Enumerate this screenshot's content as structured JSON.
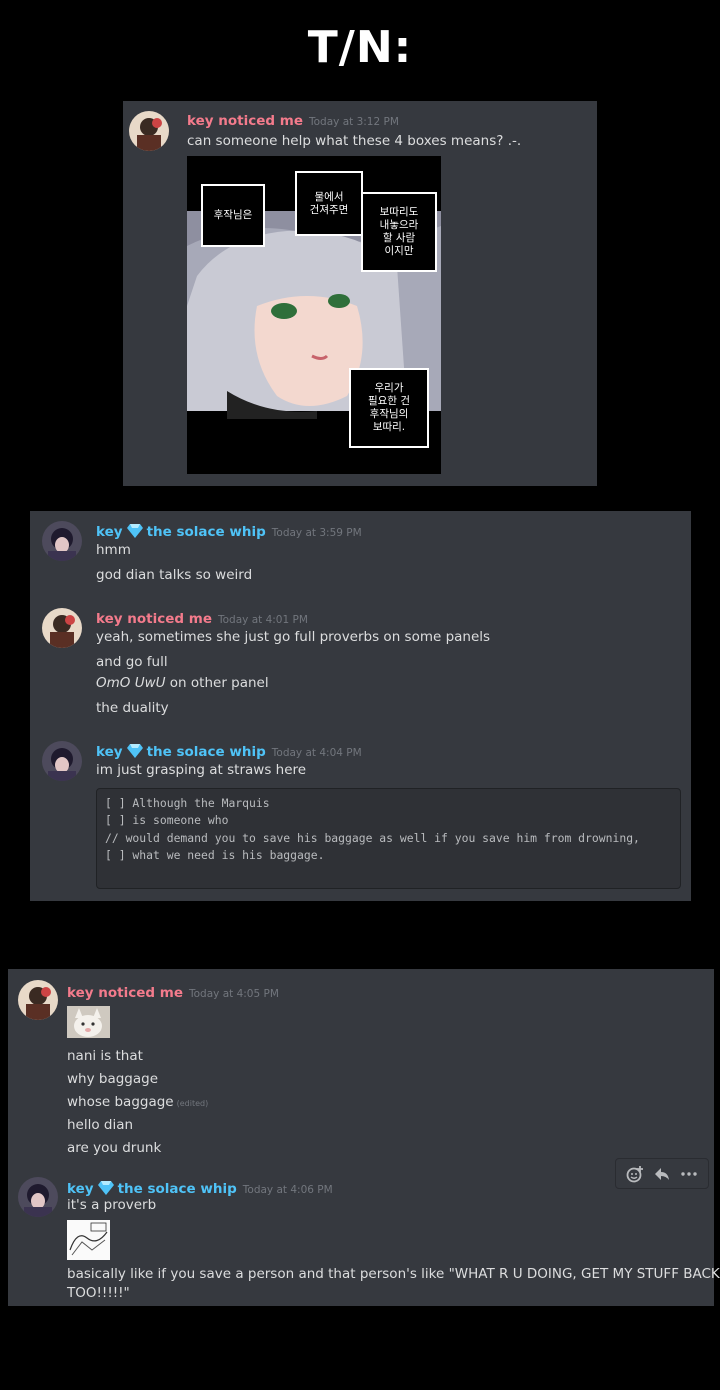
{
  "title": "T/N:",
  "users": {
    "key_noticed_me": "key noticed me",
    "key_name": "key",
    "solace_whip": "the solace whip"
  },
  "panel1": {
    "username": "key noticed me",
    "timestamp": "Today at 3:12 PM",
    "text": "can someone help what these 4 boxes means? .-.",
    "boxes": [
      "후작님은",
      "물에서\n건져주면",
      "보따리도\n내놓으라\n할 사람\n이지만",
      "우리가\n필요한 건\n후작님의\n보따리."
    ]
  },
  "panel2": {
    "m1": {
      "username_a": "key",
      "username_b": "the solace whip",
      "timestamp": "Today at 3:59 PM",
      "lines": [
        "hmm",
        "god dian talks so weird"
      ]
    },
    "m2": {
      "username": "key noticed me",
      "timestamp": "Today at 4:01 PM",
      "lines": [
        "yeah, sometimes she just go full proverbs on some panels",
        "and go full"
      ],
      "italic": "OmO UwU",
      "italic_tail": " on other panel",
      "last": "the duality"
    },
    "m3": {
      "username_a": "key",
      "username_b": "the solace whip",
      "timestamp": "Today at 4:04 PM",
      "text": "im just grasping at straws here",
      "code": [
        "[ ] Although the Marquis",
        "[ ] is someone who",
        "// would demand you to save his baggage as well if you save him from drowning,",
        "[ ] what we need is his baggage."
      ]
    }
  },
  "panel3": {
    "m1": {
      "username": "key noticed me",
      "timestamp": "Today at 4:05 PM",
      "lines": [
        "nani is that",
        "why baggage",
        "whose baggage",
        "hello dian",
        "are you drunk"
      ],
      "edited": "(edited)"
    },
    "m2": {
      "username_a": "key",
      "username_b": "the solace whip",
      "timestamp": "Today at 4:06 PM",
      "text": "it's a proverb",
      "body_1": "basically like if you save a person and that person's like \"WHAT R U DOING, GET MY STUFF BACK",
      "body_2": "TOO!!!!!\""
    }
  },
  "toolbar_icons": [
    "add-reaction-icon",
    "reply-icon",
    "more-icon"
  ]
}
